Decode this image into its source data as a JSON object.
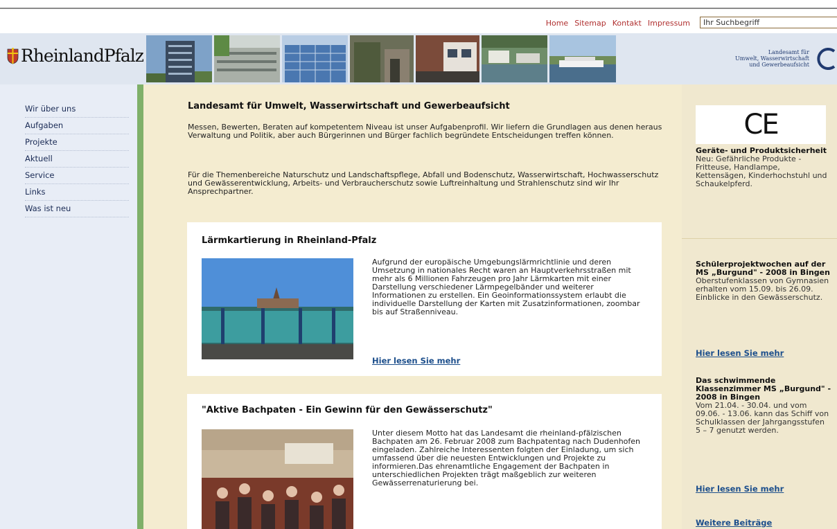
{
  "topnav": {
    "items": [
      "Home",
      "Sitemap",
      "Kontakt",
      "Impressum"
    ],
    "search_value": "Ihr Suchbegriff"
  },
  "header": {
    "logo_text": "RheinlandPfalz",
    "agency_lines": [
      "Landesamt für",
      "Umwelt, Wasserwirtschaft",
      "und Gewerbeaufsicht"
    ]
  },
  "leftnav": {
    "items": [
      "Wir über uns",
      "Aufgaben",
      "Projekte",
      "Aktuell",
      "Service",
      "Links",
      "Was ist neu"
    ]
  },
  "main": {
    "title": "Landesamt für Umwelt, Wasserwirtschaft und Gewerbeaufsicht",
    "intro1": "Messen, Bewerten, Beraten auf kompetentem Niveau ist unser Aufgabenprofil. Wir liefern die Grundlagen aus denen heraus Verwaltung und Politik, aber auch Bürgerinnen und Bürger fachlich begründete Entscheidungen treffen können.",
    "intro2": "Für die Themenbereiche Naturschutz und Landschaftspflege, Abfall und Bodenschutz, Wasserwirtschaft, Hochwasserschutz und Gewässerentwicklung, Arbeits- und Verbraucherschutz sowie Luftreinhaltung und Strahlenschutz sind wir Ihr Ansprechpartner.",
    "articles": [
      {
        "title": "Lärmkartierung in Rheinland-Pfalz",
        "text": "Aufgrund der europäische Umgebungslärmrichtlinie und deren Umsetzung in nationales Recht waren an Hauptverkehrsstraßen mit mehr als 6 Millionen Fahrzeugen pro Jahr Lärmkarten mit einer Darstellung verschiedener Lärmpegelbänder und weiterer Informationen zu erstellen. Ein Geoinformationssystem erlaubt die individuelle Darstellung der Karten mit Zusatzinformationen, zoombar bis auf Straßenniveau.",
        "more": "Hier lesen Sie mehr"
      },
      {
        "title": "\"Aktive Bachpaten - Ein Gewinn für den Gewässerschutz\"",
        "text": "Unter diesem Motto hat das Landesamt die rheinland-pfälzischen Bachpaten am 26. Februar 2008 zum Bachpatentag nach Dudenhofen eingeladen. Zahlreiche Interessenten folgten der Einladung, um sich umfassend über die neuesten Entwicklungen und Projekte zu informieren.Das ehrenamtliche Engagement der Bachpaten in unterschiedlichen Projekten trägt maßgeblich zur weiteren Gewässerrenaturierung bei."
      }
    ]
  },
  "right": {
    "ce_mark": "CE",
    "block1": {
      "title": "Geräte- und Produktsicherheit",
      "text": "Neu: Gefährliche Produkte - Fritteuse, Handlampe, Kettensägen, Kinderhochstuhl und Schaukelpferd."
    },
    "block2": {
      "title": "Schülerprojektwochen auf der MS „Burgund\" - 2008 in Bingen",
      "text": "Oberstufenklassen von Gymnasien erhalten vom 15.09. bis 26.09. Einblicke in den Gewässerschutz.",
      "more": "Hier lesen Sie mehr"
    },
    "block3": {
      "title": "Das schwimmende Klassenzimmer MS „Burgund\" - 2008 in Bingen",
      "text": "Vom 21.04. - 30.04. und vom 09.06. - 13.06. kann das Schiff von Schulklassen der Jahrgangsstufen 5 – 7 genutzt werden.",
      "more": "Hier lesen Sie mehr"
    },
    "more_posts": "Weitere Beiträge"
  },
  "colors": {
    "link": "#1d4f8c",
    "topnav": "#b03030",
    "accent_green": "#7fb069",
    "main_bg": "#f4ecd0",
    "nav_bg": "#e8edf6"
  }
}
